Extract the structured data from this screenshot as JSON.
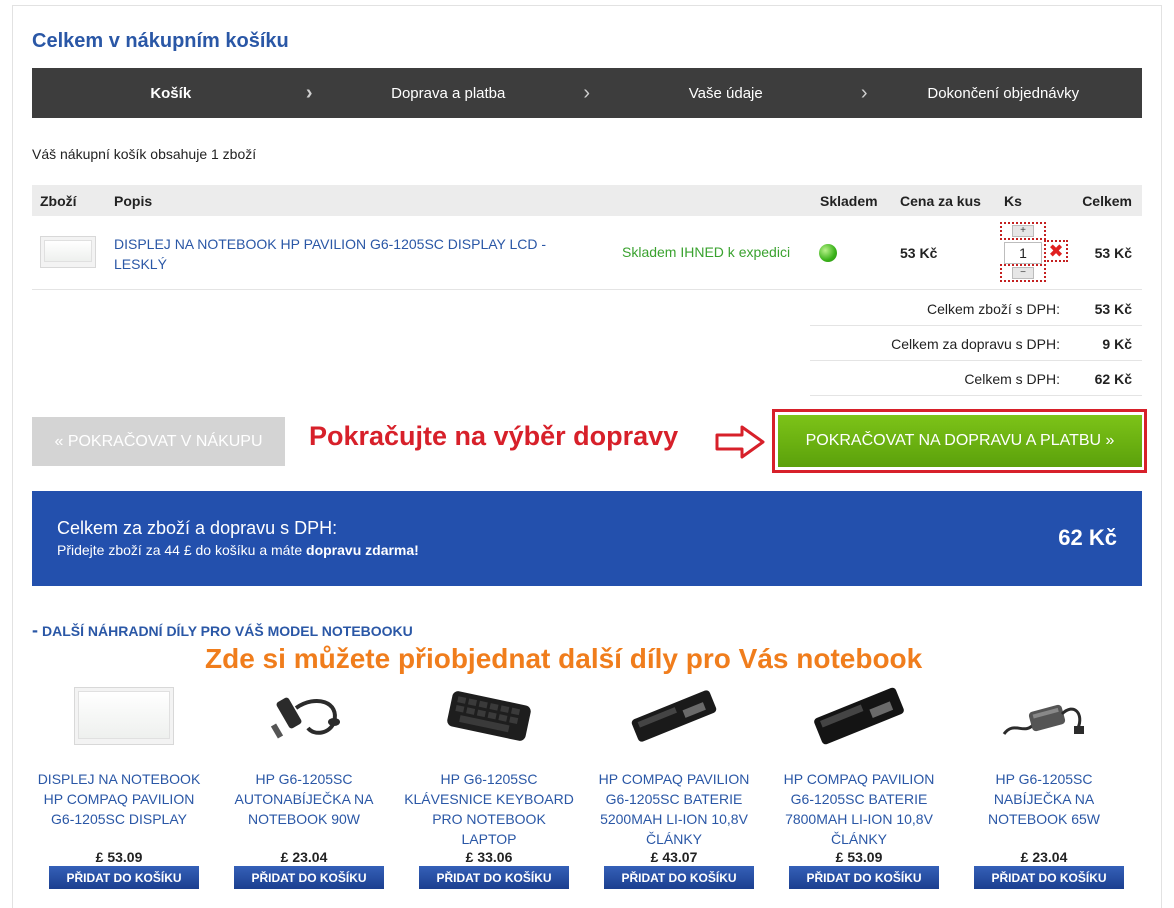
{
  "page": {
    "title": "Celkem v nákupním košíku"
  },
  "steps": [
    {
      "label": "Košík"
    },
    {
      "label": "Doprava a platba"
    },
    {
      "label": "Vaše údaje"
    },
    {
      "label": "Dokončení objednávky"
    }
  ],
  "cart": {
    "intro": "Váš nákupní košík obsahuje 1 zboží",
    "headers": {
      "item": "Zboží",
      "description": "Popis",
      "stock": "Skladem",
      "unit_price": "Cena za kus",
      "qty": "Ks",
      "total": "Celkem"
    },
    "item": {
      "name": "DISPLEJ NA NOTEBOOK HP PAVILION G6-1205SC DISPLAY LCD - LESKLÝ",
      "stock_text": "Skladem IHNED k expedici",
      "unit_price": "53 Kč",
      "qty": "1",
      "plus": "+",
      "minus": "−",
      "remove": "✖",
      "total": "53 Kč"
    },
    "summary": [
      {
        "label": "Celkem zboží s DPH:",
        "value": "53 Kč"
      },
      {
        "label": "Celkem za dopravu s DPH:",
        "value": "9 Kč"
      },
      {
        "label": "Celkem s DPH:",
        "value": "62 Kč"
      }
    ]
  },
  "actions": {
    "continue_shopping": "« POKRAČOVAT V NÁKUPU",
    "annotation": "Pokračujte na výběr dopravy",
    "next": "POKRAČOVAT NA DOPRAVU A PLATBU »"
  },
  "banner": {
    "title": "Celkem za zboží a dopravu s DPH:",
    "sub_prefix": "Přidejte zboží za 44 £ do košíku a máte ",
    "sub_bold": "dopravu zdarma!",
    "amount": "62 Kč"
  },
  "more": {
    "dash": "-",
    "heading": "DALŠÍ NÁHRADNÍ DÍLY PRO VÁŠ MODEL NOTEBOOKU",
    "annotation": "Zde si můžete přiobjednat další díly pro Vás notebook",
    "add_label": "PŘIDAT DO KOŠÍKU",
    "products": [
      {
        "name": "DISPLEJ NA NOTEBOOK HP COMPAQ PAVILION G6-1205SC DISPLAY",
        "price": "£ 53.09",
        "icon": "lcd-panel-icon"
      },
      {
        "name": "HP G6-1205SC AUTONABÍJEČKA NA NOTEBOOK 90W",
        "price": "£ 23.04",
        "icon": "car-charger-icon"
      },
      {
        "name": "HP G6-1205SC KLÁVESNICE KEYBOARD PRO NOTEBOOK LAPTOP",
        "price": "£ 33.06",
        "icon": "keyboard-icon"
      },
      {
        "name": "HP COMPAQ PAVILION G6-1205SC BATERIE 5200MAH LI-ION 10,8V ČLÁNKY",
        "price": "£ 43.07",
        "icon": "battery-icon"
      },
      {
        "name": "HP COMPAQ PAVILION G6-1205SC BATERIE 7800MAH LI-ION 10,8V ČLÁNKY",
        "price": "£ 53.09",
        "icon": "battery-icon"
      },
      {
        "name": "HP G6-1205SC NABÍJEČKA NA NOTEBOOK 65W",
        "price": "£ 23.04",
        "icon": "charger-icon"
      }
    ]
  },
  "colors": {
    "accent_blue": "#2350ad",
    "link_blue": "#2a57a6",
    "green": "#5ba10b",
    "annotation_red": "#d7202a",
    "annotation_orange": "#f07d1c"
  }
}
